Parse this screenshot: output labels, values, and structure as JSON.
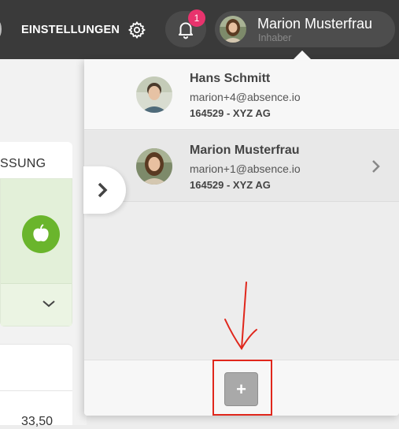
{
  "header": {
    "settings_label": "EINSTELLUNGEN",
    "notification_count": "1",
    "user_name": "Marion Musterfrau",
    "user_role": "Inhaber"
  },
  "background": {
    "card_label": "SSUNG",
    "amount": "33,50"
  },
  "accounts": [
    {
      "name": "Hans Schmitt",
      "email": "marion+4@absence.io",
      "company": "164529 - XYZ AG"
    },
    {
      "name": "Marion Musterfrau",
      "email": "marion+1@absence.io",
      "company": "164529 - XYZ AG"
    }
  ],
  "panel": {
    "add_button_label": "+"
  },
  "colors": {
    "topbar": "#3a3a3a",
    "badge": "#e8336d",
    "accent_green": "#6ab52c",
    "annotation_red": "#e0271c"
  },
  "icons": {
    "settings": "gear-icon",
    "notifications": "bell-icon",
    "absence_type": "apple-icon",
    "expand": "chevron-right-icon",
    "dropdown": "chevron-down-icon"
  }
}
